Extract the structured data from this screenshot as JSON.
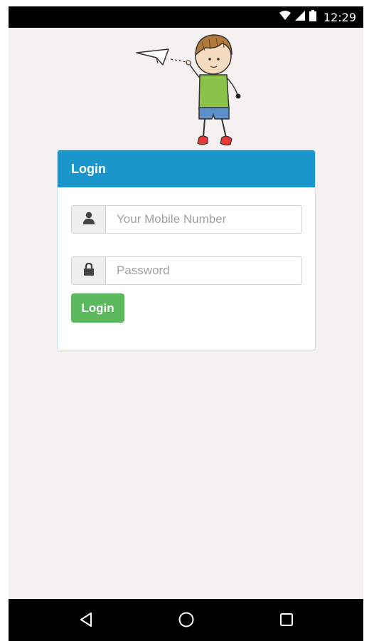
{
  "status_bar": {
    "time": "12:29",
    "icons": [
      "wifi-icon",
      "cellular-signal-icon",
      "battery-icon"
    ]
  },
  "illustration": {
    "name": "boy-with-paper-plane"
  },
  "login_card": {
    "title": "Login",
    "mobile_placeholder": "Your Mobile Number",
    "mobile_icon": "user-icon",
    "password_placeholder": "Password",
    "password_icon": "lock-icon",
    "login_button": "Login"
  },
  "nav_bar": {
    "buttons": [
      "back-icon",
      "home-icon",
      "recents-icon"
    ]
  },
  "colors": {
    "header": "#1a96cd",
    "button": "#5cb85c",
    "background": "#f6f1f1"
  }
}
